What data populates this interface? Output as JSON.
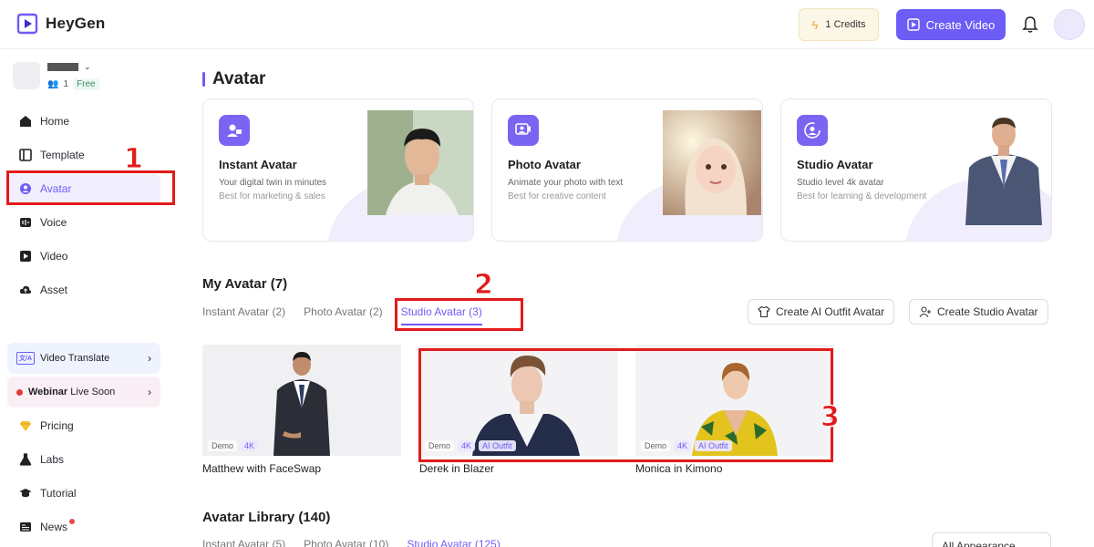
{
  "app": {
    "name": "HeyGen",
    "credits_label": "1 Credits",
    "create_video_label": "Create Video"
  },
  "workspace": {
    "member_count": "1",
    "plan": "Free"
  },
  "sidebar": {
    "items": [
      {
        "label": "Home",
        "icon": "home-icon"
      },
      {
        "label": "Template",
        "icon": "template-icon"
      },
      {
        "label": "Avatar",
        "icon": "avatar-icon"
      },
      {
        "label": "Voice",
        "icon": "voice-icon"
      },
      {
        "label": "Video",
        "icon": "video-icon"
      },
      {
        "label": "Asset",
        "icon": "cloud-icon"
      }
    ],
    "promos": [
      {
        "badge": "文/A",
        "label": "Video Translate"
      },
      {
        "bold": "Webinar",
        "label": "Live Soon"
      }
    ],
    "bottom_items": [
      {
        "label": "Pricing",
        "icon": "diamond-icon"
      },
      {
        "label": "Labs",
        "icon": "flask-icon"
      },
      {
        "label": "Tutorial",
        "icon": "hat-icon"
      },
      {
        "label": "News",
        "icon": "news-icon"
      }
    ]
  },
  "main": {
    "title": "Avatar",
    "type_cards": [
      {
        "title": "Instant Avatar",
        "line1": "Your digital twin in minutes",
        "line2": "Best for marketing & sales"
      },
      {
        "title": "Photo Avatar",
        "line1": "Animate your photo with text",
        "line2": "Best for creative content"
      },
      {
        "title": "Studio Avatar",
        "line1": "Studio level 4k avatar",
        "line2": "Best for learning & development"
      }
    ],
    "my_avatar": {
      "title": "My Avatar (7)",
      "tabs": [
        "Instant Avatar (2)",
        "Photo Avatar (2)",
        "Studio Avatar (3)"
      ],
      "active_tab": 2,
      "create_outfit_label": "Create AI Outfit Avatar",
      "create_studio_label": "Create Studio Avatar",
      "avatars": [
        {
          "name": "Matthew with FaceSwap",
          "badges": [
            "Demo",
            "4K"
          ]
        },
        {
          "name": "Derek in Blazer",
          "badges": [
            "Demo",
            "4K",
            "AI Outfit"
          ]
        },
        {
          "name": "Monica in Kimono",
          "badges": [
            "Demo",
            "4K",
            "AI Outfit"
          ]
        }
      ]
    },
    "library": {
      "title": "Avatar Library (140)",
      "tabs": [
        "Instant Avatar (5)",
        "Photo Avatar (10)",
        "Studio Avatar (125)"
      ],
      "active_tab": 2,
      "filter_label": "All Appearance"
    }
  },
  "annotations": [
    "1",
    "2",
    "3"
  ],
  "colors": {
    "accent": "#6e5cf6",
    "annotation": "#e21b1b"
  }
}
